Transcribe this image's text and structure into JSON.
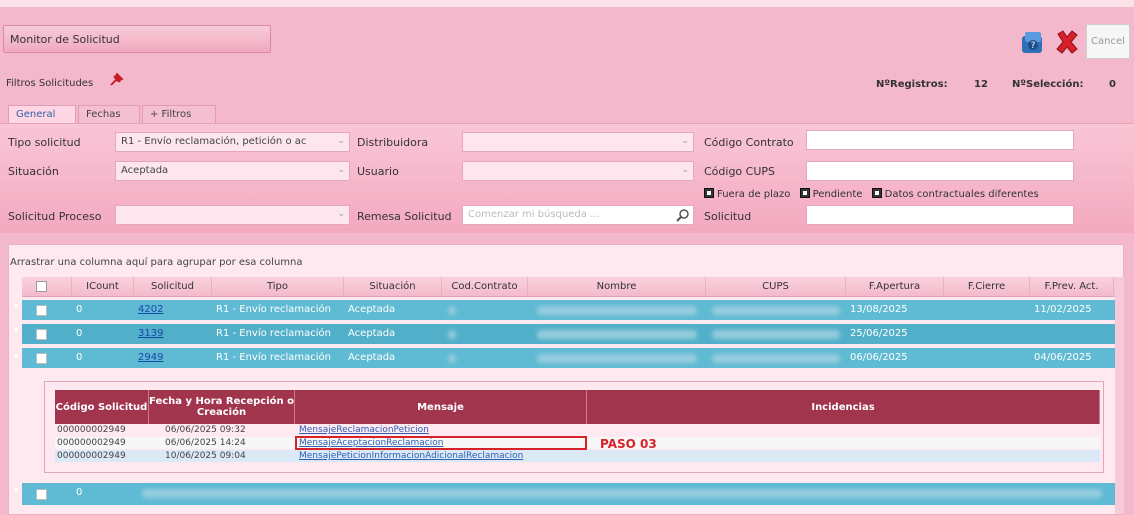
{
  "window": {
    "title": "Monitor de Solicitud"
  },
  "toolbar": {
    "help_icon": "help-icon",
    "close_icon": "close-icon",
    "cancel_label": "Cancel"
  },
  "filters_bar": {
    "label": "Filtros Solicitudes",
    "registros_label": "NºRegistros:",
    "registros_value": "12",
    "seleccion_label": "NºSelección:",
    "seleccion_value": "0"
  },
  "tabs": [
    {
      "label": "General",
      "active": true
    },
    {
      "label": "Fechas",
      "active": false
    },
    {
      "label": "+ Filtros",
      "active": false
    }
  ],
  "form": {
    "tipo_solicitud_label": "Tipo solicitud",
    "tipo_solicitud_value": "R1 - Envío reclamación, petición o ac",
    "distribuidora_label": "Distribuidora",
    "distribuidora_value": "",
    "codigo_contrato_label": "Código Contrato",
    "situacion_label": "Situación",
    "situacion_value": "Aceptada",
    "usuario_label": "Usuario",
    "usuario_value": "",
    "codigo_cups_label": "Código CUPS",
    "check_fuera_plazo": "Fuera de plazo",
    "check_pendiente": "Pendiente",
    "check_datos": "Datos contractuales diferentes",
    "solicitud_proceso_label": "Solicitud Proceso",
    "remesa_label": "Remesa Solicitud",
    "search_placeholder": "Comenzar mi búsqueda ...",
    "solicitud_label": "Solicitud"
  },
  "grid": {
    "group_hint": "Arrastrar una columna aquí para agrupar por esa columna",
    "columns": [
      "ICount",
      "Solicitud",
      "Tipo",
      "Situación",
      "Cod.Contrato",
      "Nombre",
      "CUPS",
      "F.Apertura",
      "F.Cierre",
      "F.Prev. Act."
    ],
    "rows": [
      {
        "count": "0",
        "solicitud": "4202",
        "tipo": "R1 - Envío reclamación",
        "situacion": "Aceptada",
        "f_apertura": "13/08/2025",
        "f_cierre": "",
        "f_prev": "11/02/2025"
      },
      {
        "count": "0",
        "solicitud": "3139",
        "tipo": "R1 - Envío reclamación",
        "situacion": "Aceptada",
        "f_apertura": "25/06/2025",
        "f_cierre": "",
        "f_prev": ""
      },
      {
        "count": "0",
        "solicitud": "2949",
        "tipo": "R1 - Envío reclamación",
        "situacion": "Aceptada",
        "f_apertura": "06/06/2025",
        "f_cierre": "",
        "f_prev": "04/06/2025"
      }
    ],
    "last_row_count": "0"
  },
  "detail": {
    "columns": {
      "codigo": "Código Solicitud",
      "fecha": "Fecha y Hora Recepción o Creación",
      "mensaje": "Mensaje",
      "incidencias": "Incidencias"
    },
    "rows": [
      {
        "codigo": "000000002949",
        "fecha": "06/06/2025 09:32",
        "mensaje": "MensajeReclamacionPeticion"
      },
      {
        "codigo": "000000002949",
        "fecha": "06/06/2025 14:24",
        "mensaje": "MensajeAceptacionReclamacion"
      },
      {
        "codigo": "000000002949",
        "fecha": "10/06/2025 09:04",
        "mensaje": "MensajePeticionInformacionAdicionalReclamacion"
      }
    ],
    "annotation": "PASO 03"
  }
}
